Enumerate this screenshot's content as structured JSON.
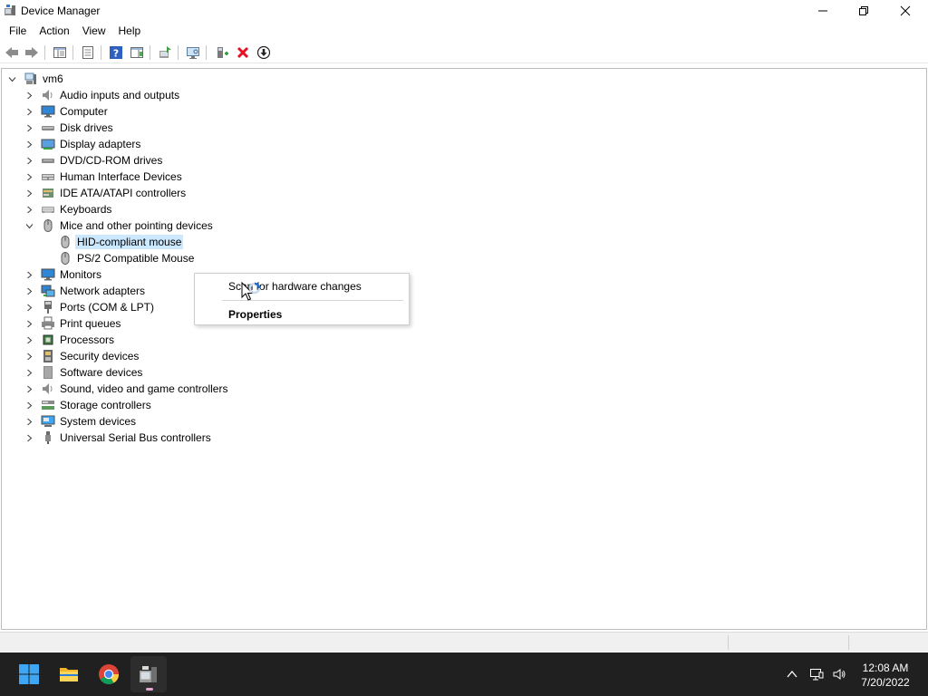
{
  "window": {
    "title": "Device Manager"
  },
  "menu": [
    "File",
    "Action",
    "View",
    "Help"
  ],
  "toolbar": {
    "icons": [
      "back-arrow-icon",
      "forward-arrow-icon",
      "show-hide-console-tree-icon",
      "properties-icon",
      "help-icon",
      "action-pane-icon",
      "update-driver-icon",
      "scan-hardware-icon",
      "add-driver-icon",
      "uninstall-icon",
      "download-icon"
    ]
  },
  "tree": {
    "root": "vm6",
    "categories": [
      {
        "label": "Audio inputs and outputs",
        "icon": "speaker-icon",
        "expanded": false
      },
      {
        "label": "Computer",
        "icon": "monitor-icon",
        "expanded": false
      },
      {
        "label": "Disk drives",
        "icon": "disk-drive-icon",
        "expanded": false
      },
      {
        "label": "Display adapters",
        "icon": "display-adapter-icon",
        "expanded": false
      },
      {
        "label": "DVD/CD-ROM drives",
        "icon": "dvd-drive-icon",
        "expanded": false
      },
      {
        "label": "Human Interface Devices",
        "icon": "hid-icon",
        "expanded": false
      },
      {
        "label": "IDE ATA/ATAPI controllers",
        "icon": "ide-controller-icon",
        "expanded": false
      },
      {
        "label": "Keyboards",
        "icon": "keyboard-icon",
        "expanded": false
      },
      {
        "label": "Mice and other pointing devices",
        "icon": "mouse-icon",
        "expanded": true,
        "children": [
          {
            "label": "HID-compliant mouse",
            "icon": "mouse-icon",
            "selected": true
          },
          {
            "label": "PS/2 Compatible Mouse",
            "icon": "mouse-icon",
            "selected": false
          }
        ]
      },
      {
        "label": "Monitors",
        "icon": "monitor-icon",
        "expanded": false
      },
      {
        "label": "Network adapters",
        "icon": "network-adapter-icon",
        "expanded": false
      },
      {
        "label": "Ports (COM & LPT)",
        "icon": "port-icon",
        "expanded": false
      },
      {
        "label": "Print queues",
        "icon": "printer-icon",
        "expanded": false
      },
      {
        "label": "Processors",
        "icon": "processor-icon",
        "expanded": false
      },
      {
        "label": "Security devices",
        "icon": "security-device-icon",
        "expanded": false
      },
      {
        "label": "Software devices",
        "icon": "software-device-icon",
        "expanded": false
      },
      {
        "label": "Sound, video and game controllers",
        "icon": "speaker-icon",
        "expanded": false
      },
      {
        "label": "Storage controllers",
        "icon": "storage-controller-icon",
        "expanded": false
      },
      {
        "label": "System devices",
        "icon": "system-device-icon",
        "expanded": false
      },
      {
        "label": "Universal Serial Bus controllers",
        "icon": "usb-icon",
        "expanded": false
      }
    ]
  },
  "context_menu": {
    "items": [
      "Scan for hardware changes",
      "Properties"
    ]
  },
  "taskbar": {
    "apps": [
      "windows-start-icon",
      "file-explorer-icon",
      "chrome-icon",
      "device-manager-icon"
    ],
    "clock_time": "12:08 AM",
    "clock_date": "7/20/2022"
  },
  "colors": {
    "selection": "#cce8ff",
    "taskbar": "#202020",
    "delete_red": "#e81123"
  }
}
